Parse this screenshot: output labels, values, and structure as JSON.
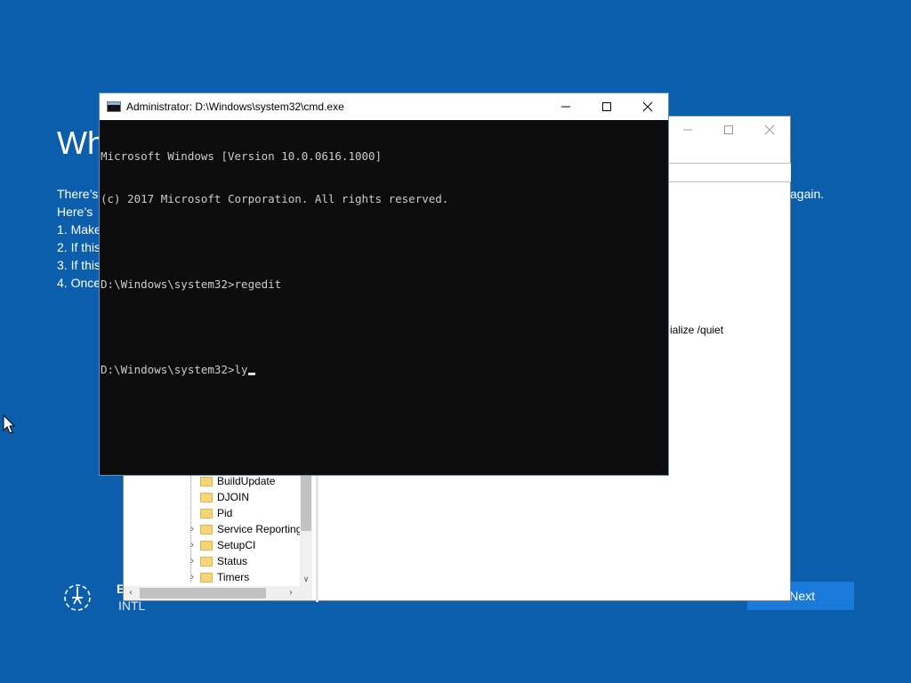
{
  "oobe": {
    "heading": "Wh",
    "body_lines": [
      "There’s",
      "Here’s",
      "1. Make",
      "2. If this",
      "3. If this",
      "4. Once"
    ],
    "trailing_text": "again.",
    "language_top": "E",
    "language_bottom": "INTL",
    "next_label": "Next"
  },
  "regedit": {
    "value_snippet": "ialize /quiet",
    "tree_items": [
      {
        "label": "BuildUpdate",
        "expandable": false
      },
      {
        "label": "DJOIN",
        "expandable": false
      },
      {
        "label": "Pid",
        "expandable": false
      },
      {
        "label": "Service Reporting",
        "expandable": true
      },
      {
        "label": "SetupCI",
        "expandable": true
      },
      {
        "label": "Status",
        "expandable": true
      },
      {
        "label": "Timers",
        "expandable": true
      }
    ]
  },
  "cmd": {
    "title": "Administrator: D:\\Windows\\system32\\cmd.exe",
    "lines": [
      "Microsoft Windows [Version 10.0.0616.1000]",
      "(c) 2017 Microsoft Corporation. All rights reserved.",
      "",
      "D:\\Windows\\system32>regedit",
      "",
      "D:\\Windows\\system32>ly"
    ]
  },
  "icons": {
    "cmd_icon": "console-icon",
    "accessibility_icon": "ease-of-access-icon",
    "cursor_icon": "mouse-pointer-icon"
  },
  "colors": {
    "oobe_background": "#0b5eac",
    "next_button": "#1a7ad9",
    "console_background": "#0c0c0c"
  }
}
